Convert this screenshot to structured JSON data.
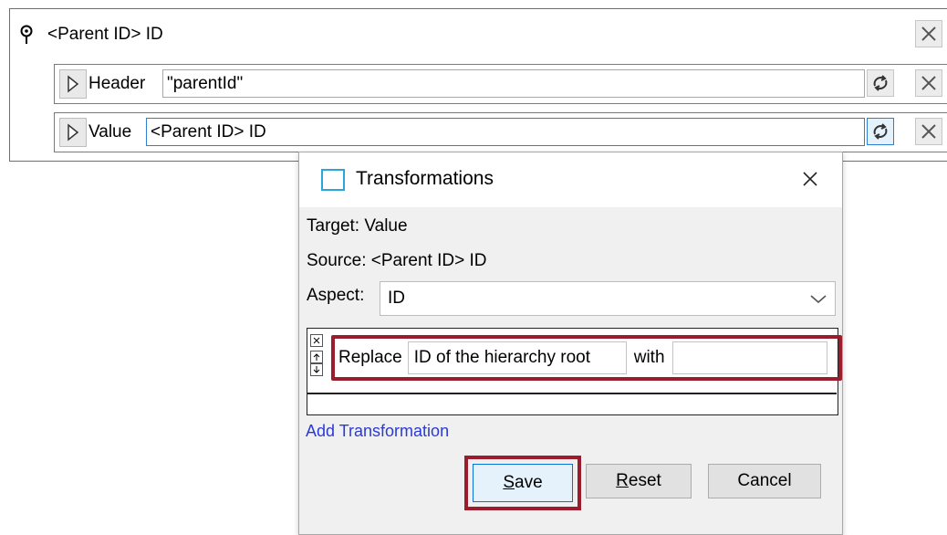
{
  "mapping": {
    "title": "<Parent ID> ID",
    "rows": [
      {
        "label": "Header",
        "value": "\"parentId\""
      },
      {
        "label": "Value",
        "value": "<Parent ID> ID"
      }
    ]
  },
  "dialog": {
    "title": "Transformations",
    "target_label": "Target:",
    "target_value": "Value",
    "source_label": "Source:",
    "source_value": "<Parent ID> ID",
    "aspect_label": "Aspect:",
    "aspect_value": "ID",
    "transformation": {
      "replace_label": "Replace",
      "replace_value": "ID of the hierarchy root",
      "with_label": "with",
      "with_value": ""
    },
    "add_transformation_label": "Add Transformation",
    "buttons": {
      "save_mnemonic": "S",
      "save_rest": "ave",
      "reset_mnemonic": "R",
      "reset_rest": "eset",
      "cancel": "Cancel"
    }
  },
  "colors": {
    "highlight": "#9b1c2c",
    "link": "#2a3ad6",
    "accent": "#2aa6d9"
  }
}
